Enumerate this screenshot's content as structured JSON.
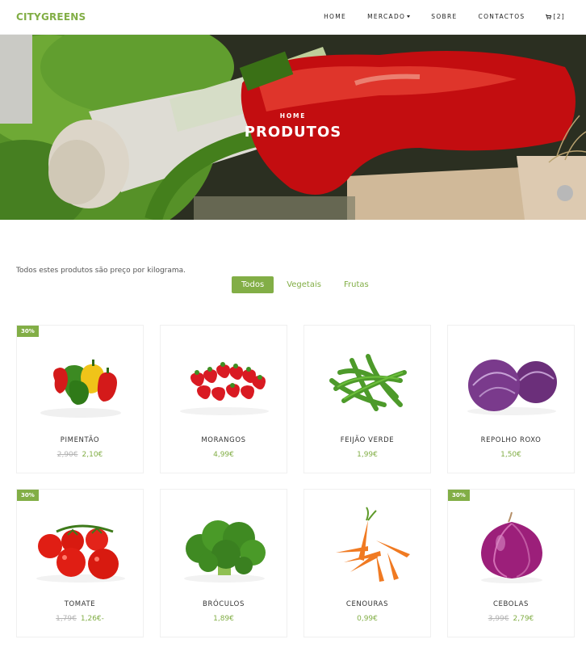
{
  "brand": "CITYGREENS",
  "nav": {
    "home": "HOME",
    "mercado": "MERCADO",
    "sobre": "SOBRE",
    "contactos": "CONTACTOS",
    "cart_count": "[2]"
  },
  "hero": {
    "breadcrumb": "HOME",
    "title": "PRODUTOS"
  },
  "note": "Todos estes produtos são preço por kilograma.",
  "filters": [
    "Todos",
    "Vegetais",
    "Frutas"
  ],
  "colors": {
    "accent": "#82ae46"
  },
  "products": [
    {
      "name": "PIMENTÃO",
      "badge": "30%",
      "old_price": "2,90€",
      "price": "2,10€",
      "icon": "bell-peppers"
    },
    {
      "name": "MORANGOS",
      "badge": "",
      "old_price": "",
      "price": "4,99€",
      "icon": "strawberries"
    },
    {
      "name": "FEIJÃO VERDE",
      "badge": "",
      "old_price": "",
      "price": "1,99€",
      "icon": "green-beans"
    },
    {
      "name": "REPOLHO ROXO",
      "badge": "",
      "old_price": "",
      "price": "1,50€",
      "icon": "red-cabbage"
    },
    {
      "name": "TOMATE",
      "badge": "30%",
      "old_price": "1,79€",
      "price": "1,26€-",
      "icon": "tomatoes"
    },
    {
      "name": "BRÓCULOS",
      "badge": "",
      "old_price": "",
      "price": "1,89€",
      "icon": "broccoli"
    },
    {
      "name": "CENOURAS",
      "badge": "",
      "old_price": "",
      "price": "0,99€",
      "icon": "carrots"
    },
    {
      "name": "CEBOLAS",
      "badge": "30%",
      "old_price": "3,99€",
      "price": "2,79€",
      "icon": "red-onion"
    }
  ]
}
